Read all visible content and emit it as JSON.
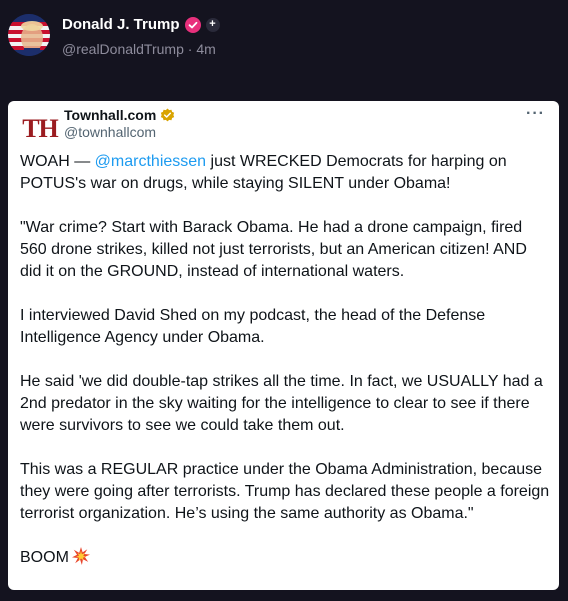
{
  "outer_post": {
    "author_name": "Donald J. Trump",
    "handle": "@realDonaldTrump",
    "separator": "·",
    "time": "4m"
  },
  "quoted_post": {
    "avatar_text": "TH",
    "author_name": "Townhall.com",
    "handle": "@townhallcom",
    "more_label": "···",
    "p1_before": "WOAH — ",
    "p1_mention": "@marcthiessen",
    "p1_after": " just WRECKED Democrats for harping on POTUS's war on drugs, while staying SILENT under Obama!",
    "p2": "\"War crime? Start with Barack Obama. He had a drone campaign, fired 560 drone strikes, killed not just terrorists, but an American citizen! AND did it on the GROUND, instead of international waters.",
    "p3": "I interviewed David Shed on my podcast, the head of the Defense Intelligence Agency under Obama.",
    "p4": "He said 'we did double-tap strikes all the time. In fact, we USUALLY had a 2nd predator in the sky waiting for the intelligence to clear to see if there were survivors to see we could take them out.",
    "p5": "This was a REGULAR practice under the Obama Administration, because they were going after terrorists. Trump has declared these people a foreign terrorist organization. He’s using the same authority as Obama.\"",
    "p6": "BOOM"
  },
  "icons": {
    "outer_verified": "verified-badge-pink",
    "outer_extra": "plus-icon",
    "quoted_verified": "verified-badge-gold",
    "more": "more-options-icon",
    "boom": "collision-emoji"
  },
  "colors": {
    "background": "#14131f",
    "card": "#ffffff",
    "link": "#1d9bf0",
    "brand_red": "#9b1c20",
    "verified_pink": "#e8307c",
    "verified_gold": "#d9a400"
  }
}
